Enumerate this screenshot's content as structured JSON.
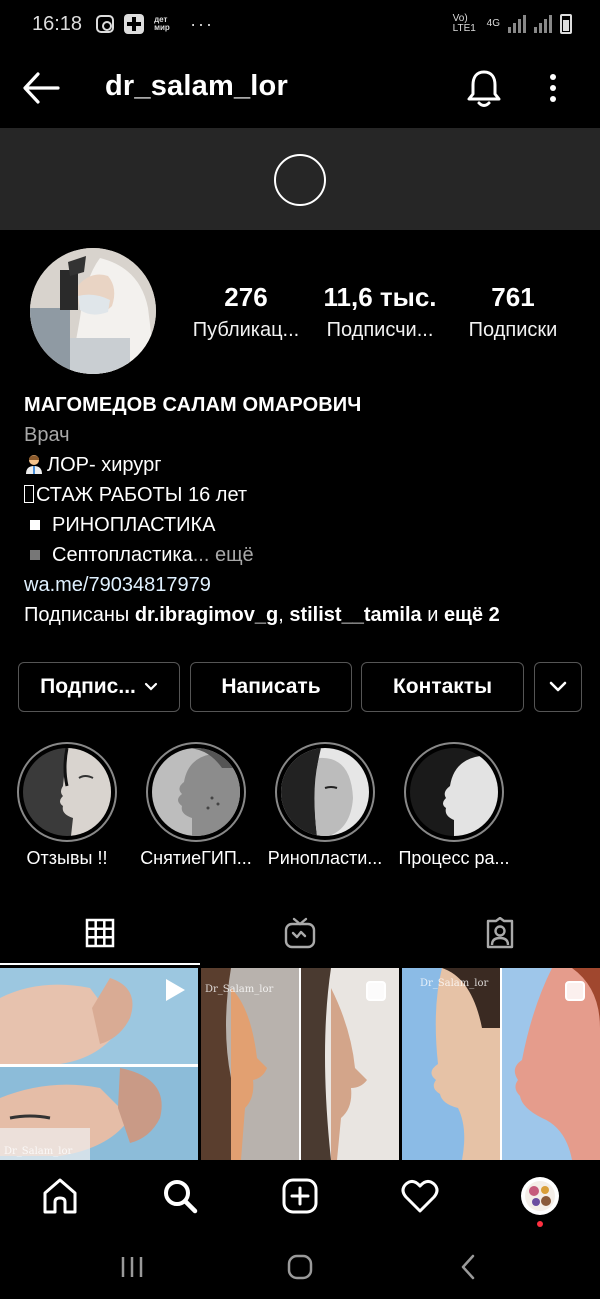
{
  "status_bar": {
    "time": "16:18",
    "mir_label": "дет мир",
    "network": "Vo) LTE1",
    "network_type": "4G"
  },
  "header": {
    "username": "dr_salam_lor"
  },
  "stats": [
    {
      "value": "276",
      "label": "Публикац..."
    },
    {
      "value": "11,6 тыс.",
      "label": "Подписчи..."
    },
    {
      "value": "761",
      "label": "Подписки"
    }
  ],
  "bio": {
    "name": "МАГОМЕДОВ САЛАМ ОМАРОВИЧ",
    "category": "Врач",
    "line1": "ЛОР- хирург",
    "line2": "СТАЖ РАБОТЫ 16 лет",
    "line3": "РИНОПЛАСТИКА",
    "line4": "Септопластика",
    "more": "... ещё",
    "link": "wa.me/79034817979",
    "followed_by_prefix": "Подписаны ",
    "followed_user_1": "dr.ibragimov_g",
    "followed_sep": ", ",
    "followed_user_2": "stilist__tamila",
    "followed_and": " и ",
    "followed_more": "ещё 2"
  },
  "buttons": {
    "subscribed": "Подпис...",
    "message": "Написать",
    "contacts": "Контакты"
  },
  "highlights": [
    {
      "label": "Отзывы !!"
    },
    {
      "label": "СнятиеГИП..."
    },
    {
      "label": "Ринопласти..."
    },
    {
      "label": "Процесс ра..."
    }
  ],
  "posts": [
    {
      "watermark": "Dr_Salam_lor"
    },
    {
      "watermark": "Dr_Salam_lor"
    },
    {
      "watermark": "Dr_Salam_lor"
    }
  ],
  "colors": {
    "background": "#000000",
    "loading_strip": "#262626",
    "link": "#e0f1ff",
    "secondary_text": "#a8a8a8",
    "notification_dot": "#ff3040"
  }
}
